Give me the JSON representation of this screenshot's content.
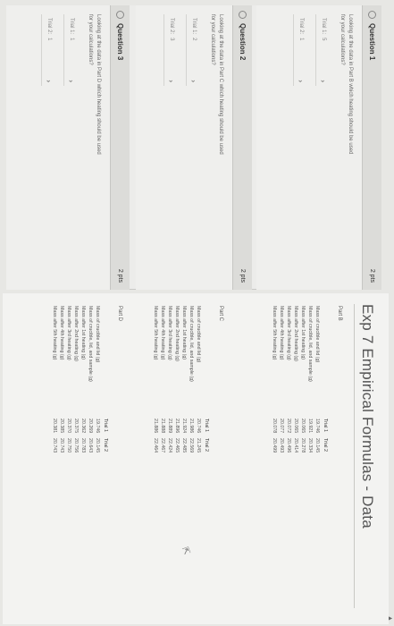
{
  "page": {
    "title": "Exp 7 Empirical Formulas - Data"
  },
  "questions": [
    {
      "title": "Question 1",
      "points": "2 pts",
      "prompt": "Looking at the data in Part B which heating should be used for your calculations?",
      "answers": [
        {
          "trial": "Trial 1:",
          "value": "5"
        },
        {
          "trial": "Trial 2:",
          "value": "1"
        }
      ]
    },
    {
      "title": "Question 2",
      "points": "2 pts",
      "prompt": "Looking at the data in Part C which heating should be used for your calculations?",
      "answers": [
        {
          "trial": "Trial 1:",
          "value": "2"
        },
        {
          "trial": "Trial 2:",
          "value": "3"
        }
      ]
    },
    {
      "title": "Question 3",
      "points": "2 pts",
      "prompt": "Looking at the data in Part D which heating should be used for your calculations?",
      "answers": [
        {
          "trial": "Trial 1:",
          "value": "1"
        },
        {
          "trial": "Trial 2:",
          "value": "1"
        }
      ]
    }
  ],
  "parts": [
    {
      "label": "Part B",
      "trial1": "Trial 1",
      "trial2": "Trial 2",
      "rows": [
        {
          "label": "Mass of crucible and lid (g)",
          "t1": "19.746",
          "t2": "20.145"
        },
        {
          "label": "Mass of crucible, lid, and sample (g)",
          "t1": "19.921",
          "t2": "20.334"
        },
        {
          "label": "Mass after 1st heating (g)",
          "t1": "20.065",
          "t2": "20.278"
        },
        {
          "label": "Mass after 2nd heating (g)",
          "t1": "20.065",
          "t2": "20.414"
        },
        {
          "label": "Mass after 3rd heating (g)",
          "t1": "20.072",
          "t2": "20.496"
        },
        {
          "label": "Mass after 4th heating (g)",
          "t1": "20.077",
          "t2": "20.493"
        },
        {
          "label": "Mass after 5th heating (g)",
          "t1": "20.078",
          "t2": "20.499"
        }
      ]
    },
    {
      "label": "Part C",
      "trial1": "Trial 1",
      "trial2": "Trial 2",
      "rows": [
        {
          "label": "Mass of crucible and lid (g)",
          "t1": "20.746",
          "t2": "21.245"
        },
        {
          "label": "Mass of crucible, lid, and sample (g)",
          "t1": "21.986",
          "t2": "22.569"
        },
        {
          "label": "Mass after 1st heating (g)",
          "t1": "21.924",
          "t2": "22.485"
        },
        {
          "label": "Mass after 2nd heating (g)",
          "t1": "21.896",
          "t2": "22.465"
        },
        {
          "label": "Mass after 3rd heating (g)",
          "t1": "21.889",
          "t2": "22.424"
        },
        {
          "label": "Mass after 4th heating (g)",
          "t1": "21.888",
          "t2": "22.467"
        },
        {
          "label": "Mass after 5th heating (g)",
          "t1": "21.886",
          "t2": "22.464"
        }
      ]
    },
    {
      "label": "Part D",
      "trial1": "Trial 1",
      "trial2": "Trial 2",
      "rows": [
        {
          "label": "Mass of crucible and lid (g)",
          "t1": "19.746",
          "t2": "20.145"
        },
        {
          "label": "Mass of crucible, lid, and sample (g)",
          "t1": "20.269",
          "t2": "20.643"
        },
        {
          "label": "Mass after 1st heating (g)",
          "t1": "20.362",
          "t2": "20.783"
        },
        {
          "label": "Mass after 2nd heating (g)",
          "t1": "20.375",
          "t2": "20.756"
        },
        {
          "label": "Mass after 3rd heating (g)",
          "t1": "20.370",
          "t2": "20.750"
        },
        {
          "label": "Mass after 4th heating (g)",
          "t1": "20.385",
          "t2": "20.743"
        },
        {
          "label": "Mass after 5th heating (g)",
          "t1": "20.381",
          "t2": "20.743"
        }
      ]
    }
  ],
  "icons": {
    "chevron": "chevron-right-icon",
    "flag": "flag-icon",
    "cursor": "mouse-cursor-icon"
  },
  "colors": {
    "page_bg": "#f3f3f1",
    "header_bg": "#dcdcd9"
  }
}
